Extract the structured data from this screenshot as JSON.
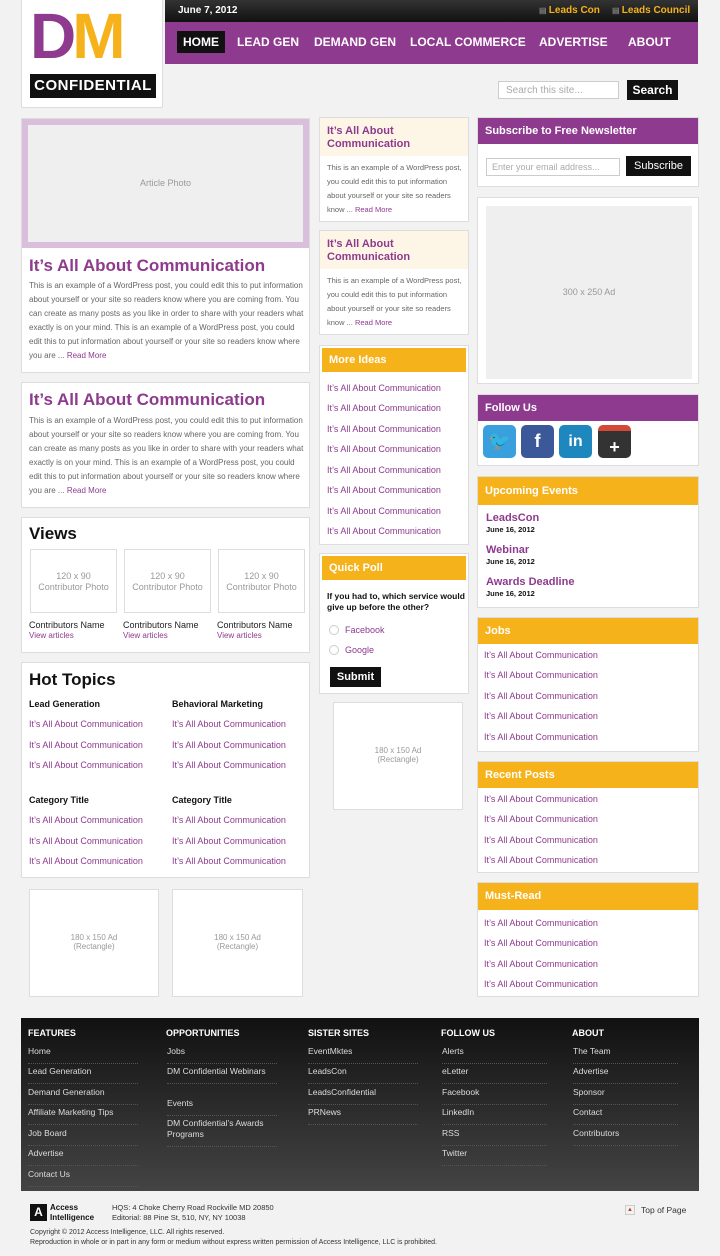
{
  "header": {
    "date": "June 7, 2012",
    "top_links": [
      "Leads Con",
      "Leads Council"
    ],
    "logo_d": "D",
    "logo_m": "M",
    "logo_sub": "CONFIDENTIAL"
  },
  "nav": [
    "HOME",
    "LEAD GEN",
    "DEMAND GEN",
    "LOCAL COMMERCE",
    "ADVERTISE",
    "ABOUT"
  ],
  "search": {
    "placeholder": "Search this site...",
    "button": "Search"
  },
  "feature": {
    "photo": "Article Photo",
    "title": "It’s All About Communication",
    "body": "This is an example of a WordPress post, you could edit this to put information about yourself or your site so readers know where you are coming from. You can create as many posts as you like in order to share with your readers what exactly is on your mind. This is an example of a WordPress post, you could edit this to put information about yourself or your site so readers know where you are ...",
    "more": "Read More"
  },
  "article2": {
    "title": "It’s All About Communication",
    "body": "This is an example of a WordPress post, you could edit this to put information about yourself or your site so readers know where you are coming from. You can create as many posts as you like in order to share with your readers what exactly is on your mind. This is an example of a WordPress post, you could edit this to put information about yourself or your site so readers know where you are ...",
    "more": "Read More"
  },
  "views": {
    "title": "Views",
    "items": [
      {
        "photo": "120 x 90\nContributor Photo",
        "name": "Contributors Name",
        "link": "View articles"
      },
      {
        "photo": "120 x 90\nContributor Photo",
        "name": "Contributors Name",
        "link": "View articles"
      },
      {
        "photo": "120 x 90\nContributor Photo",
        "name": "Contributors Name",
        "link": "View articles"
      }
    ]
  },
  "hot": {
    "title": "Hot Topics",
    "groups": [
      {
        "title": "Lead Generation",
        "items": [
          "It’s All About Communication",
          "It’s All About Communication",
          "It’s All About Communication"
        ]
      },
      {
        "title": "Behavioral Marketing",
        "items": [
          "It’s All About Communication",
          "It’s All About Communication",
          "It’s All About Communication"
        ]
      },
      {
        "title": "Category Title",
        "items": [
          "It’s All About Communication",
          "It’s All About Communication",
          "It’s All About Communication"
        ]
      },
      {
        "title": "Category Title",
        "items": [
          "It’s All About Communication",
          "It’s All About Communication",
          "It’s All About Communication"
        ]
      }
    ]
  },
  "ads_left": [
    {
      "size": "180 x 150 Ad",
      "type": "(Rectangle)"
    },
    {
      "size": "180 x 150 Ad",
      "type": "(Rectangle)"
    }
  ],
  "mid_cards": [
    {
      "title": "It’s All About Communication",
      "body": "This is an example of a WordPress post, you could edit this to put information about yourself or your site so readers know ...",
      "more": "Read More"
    },
    {
      "title": "It’s All About Communication",
      "body": "This is an example of a WordPress post, you could edit this to put information about yourself or your site so readers know ...",
      "more": "Read More"
    }
  ],
  "more_ideas": {
    "title": "More Ideas",
    "items": [
      "It’s All About Communication",
      "It’s All About Communication",
      "It’s All About Communication",
      "It’s All About Communication",
      "It’s All About Communication",
      "It’s All About Communication",
      "It’s All About Communication",
      "It’s All About Communication"
    ]
  },
  "poll": {
    "title": "Quick Poll",
    "question": "If you had to, which service would give up before the other?",
    "options": [
      "Facebook",
      "Google"
    ],
    "submit": "Submit"
  },
  "ad_mid": {
    "size": "180 x 150 Ad",
    "type": "(Rectangle)"
  },
  "newsletter": {
    "title": "Subscribe to Free Newsletter",
    "placeholder": "Enter your email address...",
    "button": "Subscribe"
  },
  "ad_right": "300 x 250 Ad",
  "follow": {
    "title": "Follow Us",
    "icons": [
      "twitter-icon",
      "facebook-icon",
      "linkedin-icon",
      "google-plus-icon"
    ]
  },
  "events": {
    "title": "Upcoming Events",
    "items": [
      {
        "name": "LeadsCon",
        "date": "June 16, 2012"
      },
      {
        "name": "Webinar",
        "date": "June 16, 2012"
      },
      {
        "name": "Awards Deadline",
        "date": "June 16, 2012"
      }
    ]
  },
  "jobs": {
    "title": "Jobs",
    "items": [
      "It’s All About Communication",
      "It’s All About Communication",
      "It’s All About Communication",
      "It’s All About Communication",
      "It’s All About Communication"
    ]
  },
  "recent": {
    "title": "Recent Posts",
    "items": [
      "It’s All About Communication",
      "It’s All About Communication",
      "It’s All About Communication",
      "It’s All About Communication"
    ]
  },
  "mustread": {
    "title": "Must-Read",
    "items": [
      "It’s All About Communication",
      "It’s All About Communication",
      "It’s All About Communication",
      "It’s All About Communication"
    ]
  },
  "footer": {
    "cols": [
      {
        "title": "FEATURES",
        "items": [
          "Home",
          "Lead Generation",
          "Demand Generation",
          "Affiliate Marketing Tips",
          "Job Board",
          "Advertise",
          "Contact Us"
        ]
      },
      {
        "title": "OPPORTUNITIES",
        "items": [
          "Jobs",
          "DM Confidential Webinars",
          "Events",
          "DM Confidential’s Awards Programs"
        ]
      },
      {
        "title": "SISTER SITES",
        "items": [
          "EventMktes",
          "LeadsCon",
          "LeadsConfidential",
          "PRNews"
        ]
      },
      {
        "title": "FOLLOW US",
        "items": [
          "Alerts",
          "eLetter",
          "Facebook",
          "LinkedIn",
          "RSS",
          "Twitter"
        ]
      },
      {
        "title": "ABOUT",
        "items": [
          "The Team",
          "Advertise",
          "Sponsor",
          "Contact",
          "Contributors"
        ]
      }
    ]
  },
  "bottom": {
    "ai1": "Access",
    "ai2": "Intelligence",
    "hq": "HQS: 4 Choke Cherry Road Rockville MD 20850",
    "editorial": "Editorial:  88 Pine St, 510, NY, NY 10038",
    "top": "Top of Page",
    "copyright": "Copyright © 2012 Access Intelligence, LLC. All rights reserved.",
    "repro": "Reproduction in whole or in part in any form or medium without express written permission of Access Intelligence, LLC is prohibited."
  }
}
